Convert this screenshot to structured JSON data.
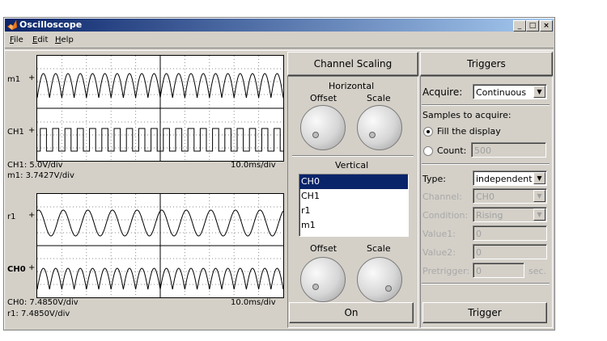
{
  "window": {
    "title": "Oscilloscope",
    "minimize": "_",
    "maximize": "□",
    "close": "×"
  },
  "menu": [
    "File",
    "Edit",
    "Help"
  ],
  "scope1": {
    "trace_top_label": "m1",
    "trace_bottom_label": "CH1",
    "scale_left_1": "CH1: 5.0V/div",
    "scale_left_2": "m1: 3.7427V/div",
    "time_div": "10.0ms/div"
  },
  "scope2": {
    "trace_top_label": "r1",
    "trace_bottom_label": "CH0",
    "scale_left_1": "CH0: 7.4850V/div",
    "scale_left_2": "r1: 7.4850V/div",
    "time_div": "10.0ms/div"
  },
  "channel_scaling": {
    "header": "Channel Scaling",
    "horizontal_label": "Horizontal",
    "offset_label": "Offset",
    "scale_label": "Scale",
    "vertical_label": "Vertical",
    "channels": [
      "CH0",
      "CH1",
      "r1",
      "m1"
    ],
    "selected_channel": "CH0",
    "v_offset_label": "Offset",
    "v_scale_label": "Scale",
    "on_button": "On"
  },
  "triggers": {
    "header": "Triggers",
    "acquire_label": "Acquire:",
    "acquire_value": "Continuous",
    "samples_label": "Samples to acquire:",
    "fill_display_label": "Fill the display",
    "count_label": "Count:",
    "count_value": "500",
    "type_label": "Type:",
    "type_value": "independent",
    "channel_label": "Channel:",
    "channel_value": "CH0",
    "condition_label": "Condition:",
    "condition_value": "Rising",
    "value1_label": "Value1:",
    "value1_value": "0",
    "value2_label": "Value2:",
    "value2_value": "0",
    "pretrigger_label": "Pretrigger:",
    "pretrigger_value": "0",
    "pretrigger_unit": "sec.",
    "trigger_button": "Trigger"
  },
  "icons": {
    "app": "matlab-icon"
  }
}
